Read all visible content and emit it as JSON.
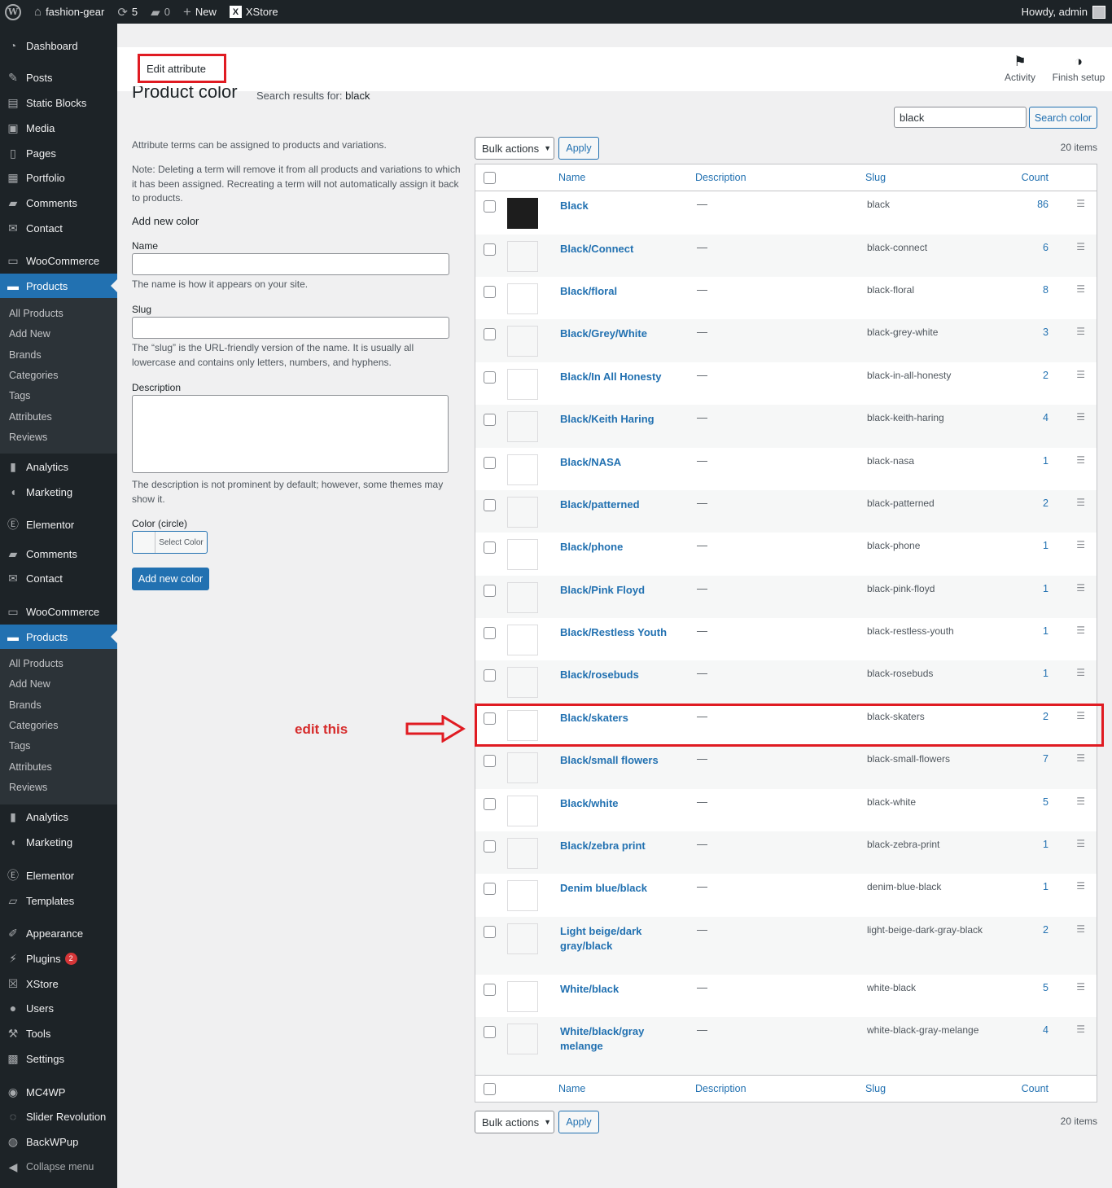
{
  "adminbar": {
    "site_name": "fashion-gear",
    "updates_count": "5",
    "comments_count": "0",
    "new_label": "New",
    "xstore_label": "XStore",
    "greeting": "Howdy, admin"
  },
  "sidebar": {
    "top_items": [
      {
        "label": "Dashboard",
        "icon": "dashboard-icon"
      },
      {
        "label": "Posts",
        "icon": "pin-icon"
      },
      {
        "label": "Static Blocks",
        "icon": "blocks-icon"
      },
      {
        "label": "Media",
        "icon": "media-icon"
      },
      {
        "label": "Pages",
        "icon": "pages-icon"
      },
      {
        "label": "Portfolio",
        "icon": "portfolio-icon"
      },
      {
        "label": "Comments",
        "icon": "comment-icon"
      },
      {
        "label": "Contact",
        "icon": "mail-icon"
      },
      {
        "label": "WooCommerce",
        "icon": "woo-icon"
      },
      {
        "label": "Products",
        "icon": "products-icon"
      }
    ],
    "submenu": [
      "All Products",
      "Add New",
      "Brands",
      "Categories",
      "Tags",
      "Attributes",
      "Reviews"
    ],
    "mid_items": [
      {
        "label": "Analytics",
        "icon": "analytics-icon"
      },
      {
        "label": "Marketing",
        "icon": "megaphone-icon"
      },
      {
        "label": "Elementor",
        "icon": "elementor-icon"
      },
      {
        "label": "Comments",
        "icon": "comment-icon"
      },
      {
        "label": "Contact",
        "icon": "mail-icon"
      },
      {
        "label": "WooCommerce",
        "icon": "woo-icon"
      },
      {
        "label": "Products",
        "icon": "products-icon"
      }
    ],
    "submenu2": [
      "All Products",
      "Add New",
      "Brands",
      "Categories",
      "Tags",
      "Attributes",
      "Reviews"
    ],
    "bottom_items": [
      {
        "label": "Analytics",
        "icon": "analytics-icon"
      },
      {
        "label": "Marketing",
        "icon": "megaphone-icon"
      },
      {
        "label": "Elementor",
        "icon": "elementor-icon"
      },
      {
        "label": "Templates",
        "icon": "folder-icon"
      },
      {
        "label": "Appearance",
        "icon": "brush-icon"
      },
      {
        "label": "Plugins",
        "icon": "plugin-icon",
        "badge": "2"
      },
      {
        "label": "XStore",
        "icon": "xstore-icon"
      },
      {
        "label": "Users",
        "icon": "users-icon"
      },
      {
        "label": "Tools",
        "icon": "wrench-icon"
      },
      {
        "label": "Settings",
        "icon": "settings-icon"
      },
      {
        "label": "MC4WP",
        "icon": "mc4wp-icon"
      },
      {
        "label": "Slider Revolution",
        "icon": "slider-icon"
      },
      {
        "label": "BackWPup",
        "icon": "backup-icon"
      }
    ],
    "collapse_label": "Collapse menu"
  },
  "header": {
    "edit_attribute": "Edit attribute",
    "activity": "Activity",
    "finish_setup": "Finish setup"
  },
  "page": {
    "title": "Product color",
    "search_results_prefix": "Search results for:",
    "search_term": "black"
  },
  "search": {
    "value": "black",
    "button": "Search color"
  },
  "form": {
    "intro": "Attribute terms can be assigned to products and variations.",
    "note": "Note: Deleting a term will remove it from all products and variations to which it has been assigned. Recreating a term will not automatically assign it back to products.",
    "heading": "Add new color",
    "name_label": "Name",
    "name_help": "The name is how it appears on your site.",
    "slug_label": "Slug",
    "slug_help": "The “slug” is the URL-friendly version of the name. It is usually all lowercase and contains only letters, numbers, and hyphens.",
    "description_label": "Description",
    "description_help": "The description is not prominent by default; however, some themes may show it.",
    "color_label": "Color (circle)",
    "select_color": "Select Color",
    "submit": "Add new color"
  },
  "table": {
    "bulk_actions": "Bulk actions",
    "apply": "Apply",
    "items_count": "20 items",
    "columns": {
      "name": "Name",
      "description": "Description",
      "slug": "Slug",
      "count": "Count"
    },
    "rows": [
      {
        "name": "Black",
        "description": "—",
        "slug": "black",
        "count": "86",
        "swatch": "#1d1d1d"
      },
      {
        "name": "Black/Connect",
        "description": "—",
        "slug": "black-connect",
        "count": "6"
      },
      {
        "name": "Black/floral",
        "description": "—",
        "slug": "black-floral",
        "count": "8"
      },
      {
        "name": "Black/Grey/White",
        "description": "—",
        "slug": "black-grey-white",
        "count": "3"
      },
      {
        "name": "Black/In All Honesty",
        "description": "—",
        "slug": "black-in-all-honesty",
        "count": "2"
      },
      {
        "name": "Black/Keith Haring",
        "description": "—",
        "slug": "black-keith-haring",
        "count": "4"
      },
      {
        "name": "Black/NASA",
        "description": "—",
        "slug": "black-nasa",
        "count": "1"
      },
      {
        "name": "Black/patterned",
        "description": "—",
        "slug": "black-patterned",
        "count": "2"
      },
      {
        "name": "Black/phone",
        "description": "—",
        "slug": "black-phone",
        "count": "1"
      },
      {
        "name": "Black/Pink Floyd",
        "description": "—",
        "slug": "black-pink-floyd",
        "count": "1"
      },
      {
        "name": "Black/Restless Youth",
        "description": "—",
        "slug": "black-restless-youth",
        "count": "1"
      },
      {
        "name": "Black/rosebuds",
        "description": "—",
        "slug": "black-rosebuds",
        "count": "1"
      },
      {
        "name": "Black/skaters",
        "description": "—",
        "slug": "black-skaters",
        "count": "2"
      },
      {
        "name": "Black/small flowers",
        "description": "—",
        "slug": "black-small-flowers",
        "count": "7"
      },
      {
        "name": "Black/white",
        "description": "—",
        "slug": "black-white",
        "count": "5"
      },
      {
        "name": "Black/zebra print",
        "description": "—",
        "slug": "black-zebra-print",
        "count": "1"
      },
      {
        "name": "Denim blue/black",
        "description": "—",
        "slug": "denim-blue-black",
        "count": "1"
      },
      {
        "name": "Light beige/dark gray/black",
        "description": "—",
        "slug": "light-beige-dark-gray-black",
        "count": "2"
      },
      {
        "name": "White/black",
        "description": "—",
        "slug": "white-black",
        "count": "5"
      },
      {
        "name": "White/black/gray melange",
        "description": "—",
        "slug": "white-black-gray-melange",
        "count": "4"
      }
    ]
  },
  "annotation": {
    "label": "edit this",
    "color": "#e01b22"
  },
  "colors": {
    "accent": "#2271b1",
    "adminbar": "#1d2327",
    "annotation": "#e01b22"
  }
}
